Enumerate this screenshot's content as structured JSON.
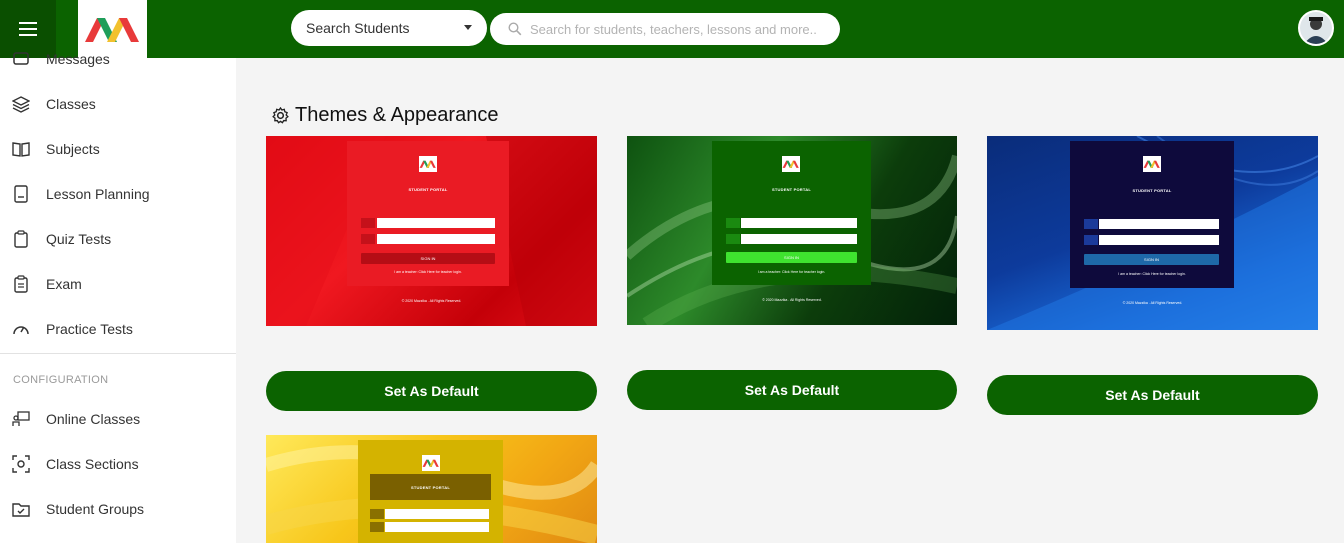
{
  "header": {
    "search_type_label": "Search Students",
    "search_placeholder": "Search for students, teachers, lessons and more.."
  },
  "sidebar": {
    "items": [
      {
        "label": "Messages",
        "icon": "message-icon"
      },
      {
        "label": "Classes",
        "icon": "layers-icon"
      },
      {
        "label": "Subjects",
        "icon": "book-open-icon"
      },
      {
        "label": "Lesson Planning",
        "icon": "planner-book-icon"
      },
      {
        "label": "Quiz Tests",
        "icon": "clipboard-icon"
      },
      {
        "label": "Exam",
        "icon": "clipboard-list-icon"
      },
      {
        "label": "Practice Tests",
        "icon": "gauge-icon"
      }
    ],
    "section_label": "CONFIGURATION",
    "config_items": [
      {
        "label": "Online Classes",
        "icon": "teacher-board-icon"
      },
      {
        "label": "Class Sections",
        "icon": "focus-frame-icon"
      },
      {
        "label": "Student Groups",
        "icon": "folder-check-icon"
      }
    ]
  },
  "main": {
    "title": "Themes & Appearance",
    "themes": [
      {
        "name": "red",
        "panel_title": "STUDENT PORTAL",
        "button_label": "SIGN IN",
        "note": "I am a teacher: Click Here for teacher login.",
        "footer": "© 2020 Mazzika . All Rights Reserved.",
        "accent": "#e8111b",
        "set_default_label": "Set As Default"
      },
      {
        "name": "green",
        "panel_title": "STUDENT PORTAL",
        "button_label": "SIGN IN",
        "note": "I am a teacher: Click Here for teacher login.",
        "footer": "© 2020 Mazzika . All Rights Reserved.",
        "accent": "#0b6300",
        "set_default_label": "Set As Default"
      },
      {
        "name": "blue",
        "panel_title": "STUDENT PORTAL",
        "button_label": "SIGN IN",
        "note": "I am a teacher: Click Here for teacher login.",
        "footer": "© 2020 Mazzika . All Rights Reserved.",
        "accent": "#0e0a3c",
        "set_default_label": "Set As Default"
      },
      {
        "name": "yellow",
        "panel_title": "STUDENT PORTAL",
        "accent": "#d4b300"
      }
    ]
  },
  "colors": {
    "brand_green": "#0b6300",
    "brand_green_dark": "#0a4f00",
    "page_bg": "#f4f4f4"
  }
}
